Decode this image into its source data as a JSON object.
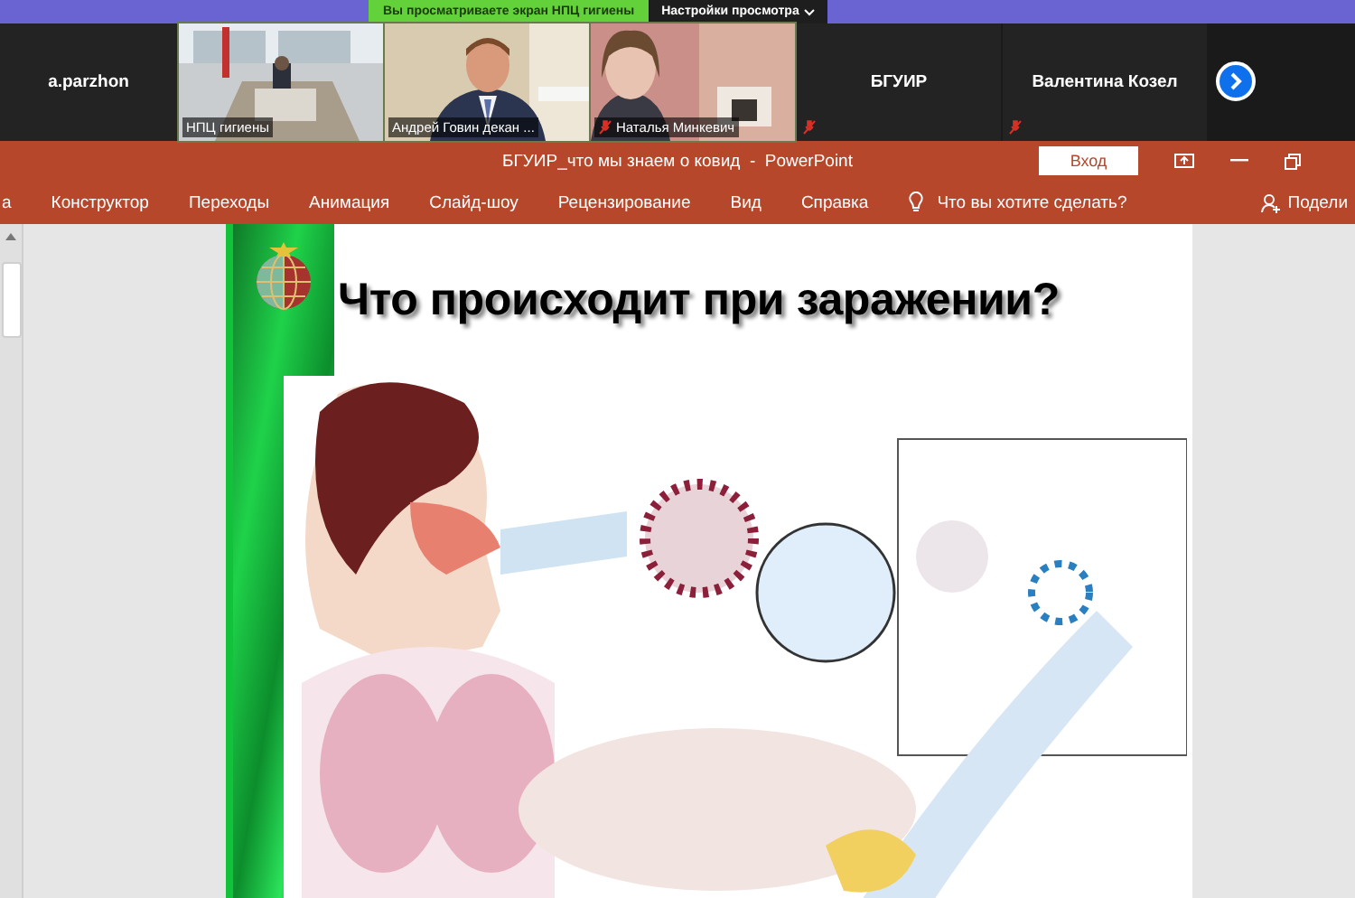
{
  "banner": {
    "notice": "Вы просматриваете экран НПЦ гигиены",
    "view_options": "Настройки просмотра"
  },
  "participants": [
    {
      "name": "a.parzhon",
      "kind": "name",
      "muted": false
    },
    {
      "name": "НПЦ гигиены",
      "kind": "video",
      "muted": false
    },
    {
      "name": "Андрей Говин декан ...",
      "kind": "video",
      "muted": false
    },
    {
      "name": "Наталья Минкевич",
      "kind": "video",
      "muted": true
    },
    {
      "name": "БГУИР",
      "kind": "name",
      "muted": true
    },
    {
      "name": "Валентина Козел",
      "kind": "name",
      "muted": true
    }
  ],
  "powerpoint": {
    "title": "БГУИР_что мы знаем о ковид  -  PowerPoint",
    "sign_in": "Вход",
    "tabs": [
      {
        "label": "а",
        "selected": false
      },
      {
        "label": "Конструктор",
        "selected": false
      },
      {
        "label": "Переходы",
        "selected": false
      },
      {
        "label": "Анимация",
        "selected": false
      },
      {
        "label": "Слайд-шоу",
        "selected": false
      },
      {
        "label": "Рецензирование",
        "selected": false
      },
      {
        "label": "Вид",
        "selected": false
      },
      {
        "label": "Справка",
        "selected": false
      }
    ],
    "tell_me": "Что вы хотите сделать?",
    "share": "Подели"
  },
  "slide": {
    "title": "Что происходит при заражении?"
  }
}
